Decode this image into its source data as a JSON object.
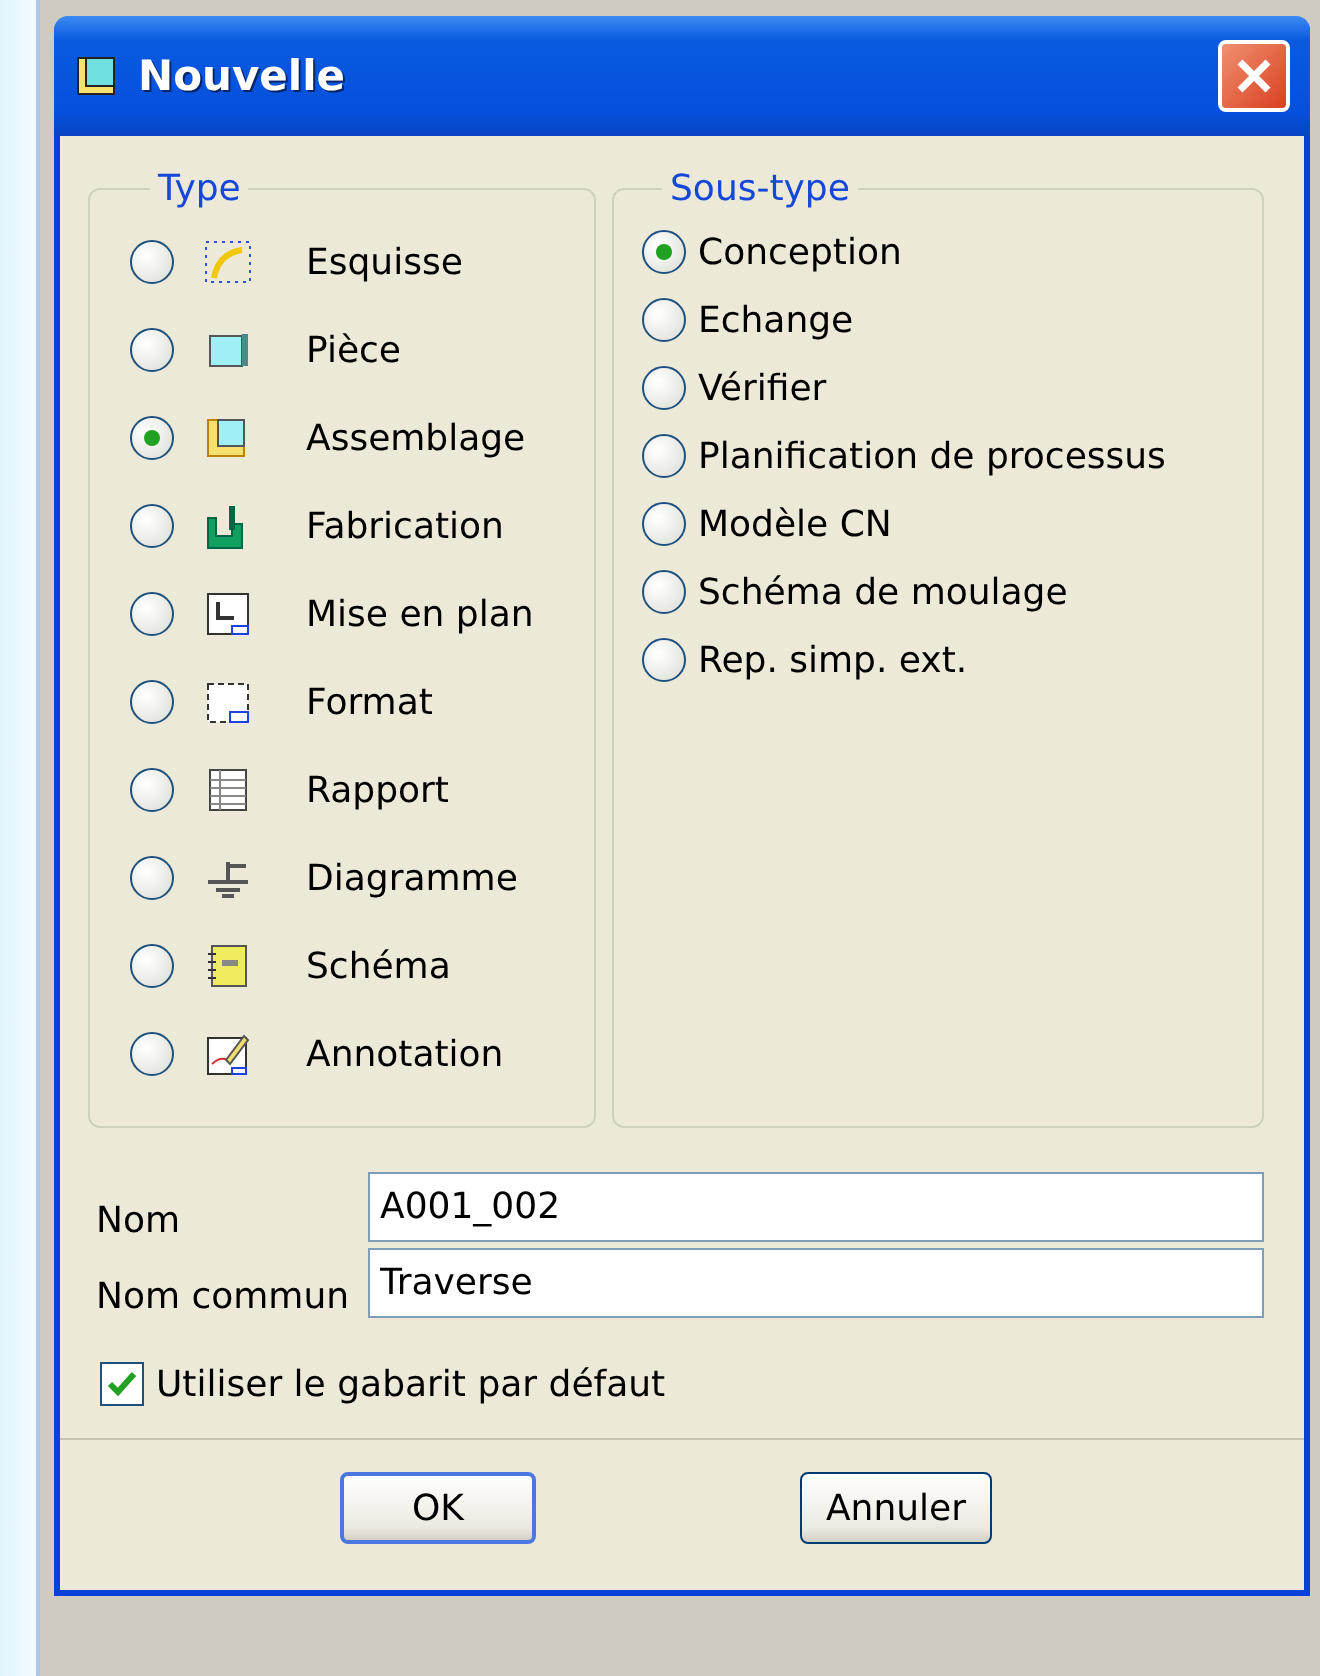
{
  "window": {
    "title": "Nouvelle"
  },
  "type_group": {
    "label": "Type",
    "items": [
      {
        "label": "Esquisse",
        "selected": false
      },
      {
        "label": "Pièce",
        "selected": false
      },
      {
        "label": "Assemblage",
        "selected": true
      },
      {
        "label": "Fabrication",
        "selected": false
      },
      {
        "label": "Mise en plan",
        "selected": false
      },
      {
        "label": "Format",
        "selected": false
      },
      {
        "label": "Rapport",
        "selected": false
      },
      {
        "label": "Diagramme",
        "selected": false
      },
      {
        "label": "Schéma",
        "selected": false
      },
      {
        "label": "Annotation",
        "selected": false
      }
    ]
  },
  "subtype_group": {
    "label": "Sous-type",
    "items": [
      {
        "label": "Conception",
        "selected": true
      },
      {
        "label": "Echange",
        "selected": false
      },
      {
        "label": "Vérifier",
        "selected": false
      },
      {
        "label": "Planification de processus",
        "selected": false
      },
      {
        "label": "Modèle CN",
        "selected": false
      },
      {
        "label": "Schéma de moulage",
        "selected": false
      },
      {
        "label": "Rep. simp. ext.",
        "selected": false
      }
    ]
  },
  "fields": [
    {
      "label": "Nom",
      "value": "A001_002"
    },
    {
      "label": "Nom commun",
      "value": "Traverse"
    }
  ],
  "use_default_template": {
    "label": "Utiliser le gabarit par défaut",
    "checked": true
  },
  "buttons": [
    "OK",
    "Annuler"
  ]
}
